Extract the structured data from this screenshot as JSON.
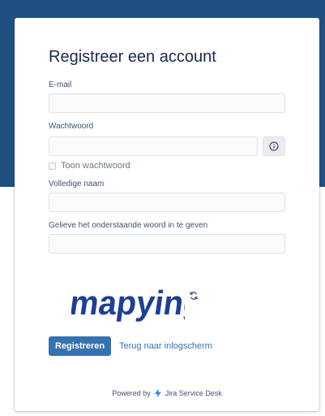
{
  "form": {
    "title": "Registreer een account",
    "email_label": "E-mail",
    "email_value": "",
    "password_label": "Wachtwoord",
    "password_value": "",
    "show_password_label": "Toon wachtwoord",
    "fullname_label": "Volledige naam",
    "fullname_value": "",
    "captcha_label": "Gelieve het onderstaande woord in te geven",
    "captcha_value": "",
    "captcha_word": "mapying",
    "register_label": "Registreren",
    "back_link_label": "Terug naar inlogscherm"
  },
  "footer": {
    "powered_by": "Powered by",
    "product": "Jira Service Desk"
  },
  "colors": {
    "header_band": "#205081",
    "primary_button": "#3572b0",
    "captcha_ink": "#1f3f96",
    "logo_blue": "#2684ff"
  },
  "icons": {
    "info": "info-icon",
    "refresh": "refresh-icon",
    "logo": "jira-service-desk-logo-icon"
  }
}
